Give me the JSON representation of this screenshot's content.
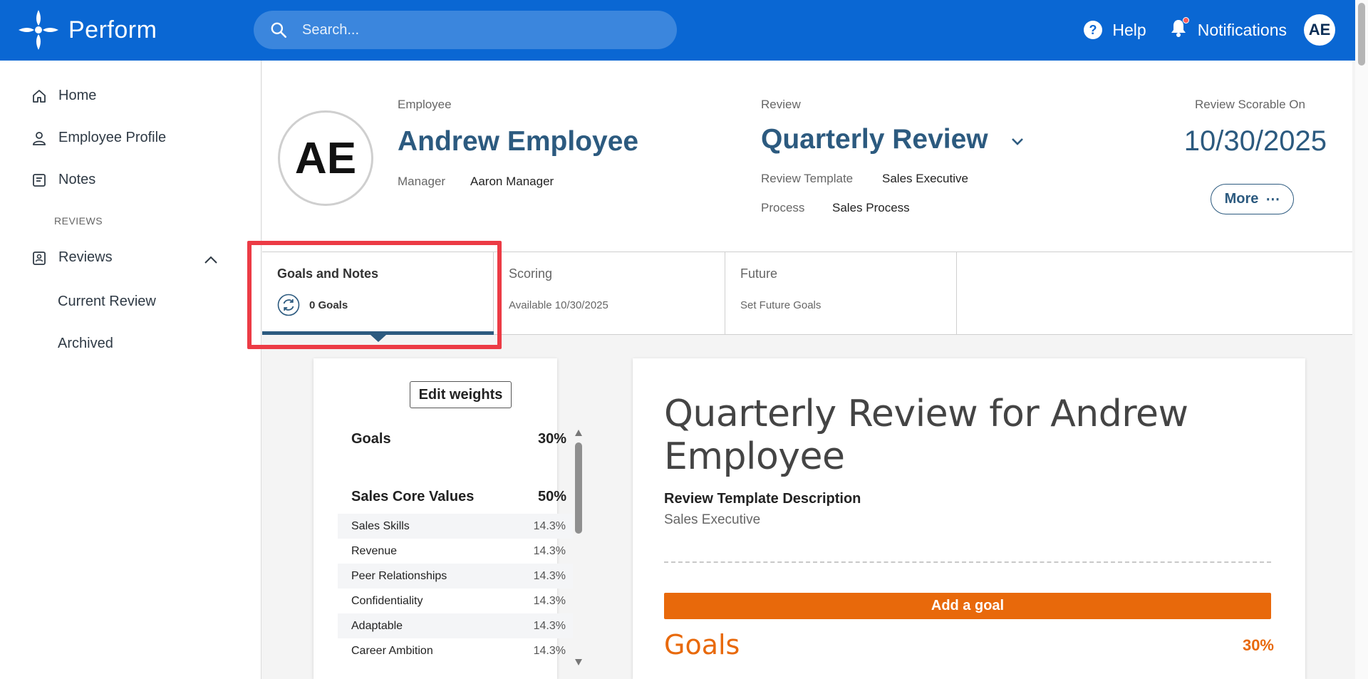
{
  "app": {
    "name": "Perform"
  },
  "search": {
    "placeholder": "Search..."
  },
  "topnav": {
    "help_label": "Help",
    "notifications_label": "Notifications",
    "user_initials": "AE"
  },
  "sidebar": {
    "items": [
      {
        "label": "Home",
        "icon": "home-icon"
      },
      {
        "label": "Employee Profile",
        "icon": "person-icon"
      },
      {
        "label": "Notes",
        "icon": "notes-icon"
      }
    ],
    "section_label": "REVIEWS",
    "reviews_label": "Reviews",
    "sub_items": [
      "Current Review",
      "Archived"
    ]
  },
  "header": {
    "employee_label": "Employee",
    "employee_name": "Andrew Employee",
    "employee_initials": "AE",
    "manager_label": "Manager",
    "manager_name": "Aaron Manager",
    "review_label": "Review",
    "review_name": "Quarterly Review",
    "template_label": "Review Template",
    "template_value": "Sales Executive",
    "process_label": "Process",
    "process_value": "Sales Process",
    "scorable_label": "Review Scorable On",
    "scorable_date": "10/30/2025",
    "more_label": "More",
    "more_icon": "⋯"
  },
  "tabs": [
    {
      "title": "Goals and Notes",
      "sub": "0 Goals",
      "active": true
    },
    {
      "title": "Scoring",
      "sub": "Available 10/30/2025",
      "active": false
    },
    {
      "title": "Future",
      "sub": "Set Future Goals",
      "active": false
    }
  ],
  "weights": {
    "edit_label": "Edit weights",
    "goals_label": "Goals",
    "goals_pct": "30%",
    "core_label": "Sales Core Values",
    "core_pct": "50%",
    "rows": [
      {
        "label": "Sales Skills",
        "pct": "14.3%"
      },
      {
        "label": "Revenue",
        "pct": "14.3%"
      },
      {
        "label": "Peer Relationships",
        "pct": "14.3%"
      },
      {
        "label": "Confidentiality",
        "pct": "14.3%"
      },
      {
        "label": "Adaptable",
        "pct": "14.3%"
      },
      {
        "label": "Career Ambition",
        "pct": "14.3%"
      }
    ]
  },
  "review_card": {
    "title": "Quarterly Review for Andrew Employee",
    "desc_label": "Review Template Description",
    "desc_value": "Sales Executive",
    "add_goal_label": "Add a goal",
    "goals_heading": "Goals",
    "goals_pct": "30%"
  },
  "colors": {
    "brand": "#0a67d3",
    "accent": "#e8690b",
    "heading": "#2c5a7f",
    "highlight": "#ec3b45"
  }
}
